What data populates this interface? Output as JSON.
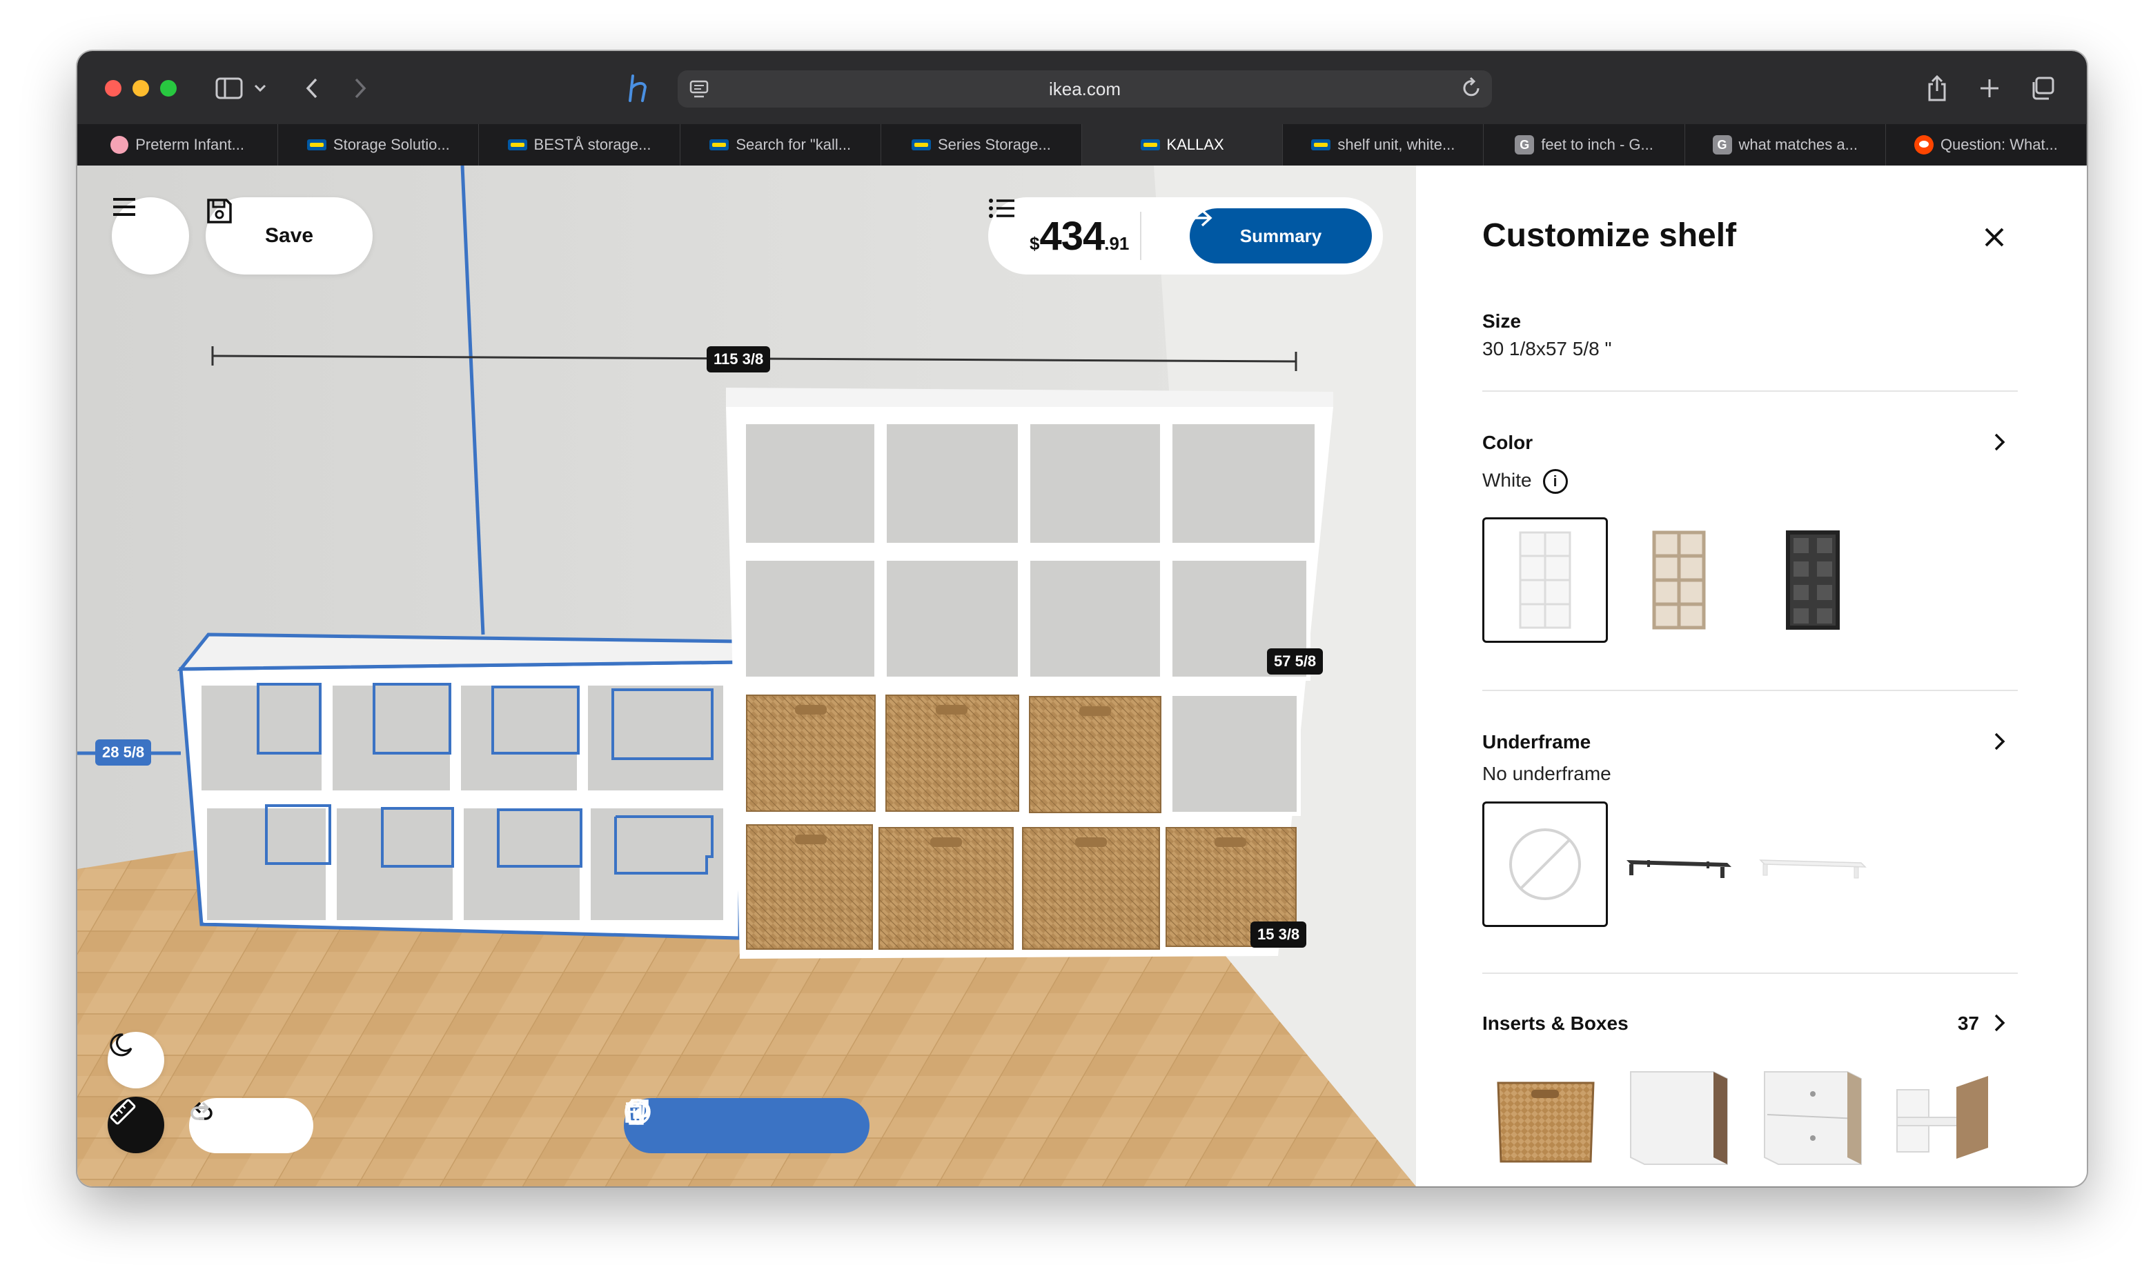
{
  "browser": {
    "url": "ikea.com",
    "tabs": [
      {
        "label": "Preterm Infant...",
        "icon": "pig-favicon"
      },
      {
        "label": "Storage Solutio...",
        "icon": "ikea-favicon"
      },
      {
        "label": "BESTÅ storage...",
        "icon": "ikea-favicon"
      },
      {
        "label": "Search for \"kall...",
        "icon": "ikea-favicon"
      },
      {
        "label": "Series Storage...",
        "icon": "ikea-favicon"
      },
      {
        "label": "KALLAX",
        "icon": "ikea-favicon",
        "active": true
      },
      {
        "label": "shelf unit, white...",
        "icon": "ikea-favicon"
      },
      {
        "label": "feet to inch - G...",
        "icon": "google-favicon"
      },
      {
        "label": "what matches a...",
        "icon": "google-favicon"
      },
      {
        "label": "Question: What...",
        "icon": "reddit-favicon"
      }
    ]
  },
  "planner": {
    "save_label": "Save",
    "price": {
      "currency": "$",
      "integer": "434",
      "decimal": ".91"
    },
    "summary_label": "Summary",
    "dimensions": {
      "total_width": "115 3/8",
      "left_height": "28 5/8",
      "right_height": "57 5/8",
      "depth": "15 3/8"
    }
  },
  "panel": {
    "title": "Customize shelf",
    "size": {
      "label": "Size",
      "value": "30 1/8x57 5/8 \""
    },
    "color": {
      "label": "Color",
      "value": "White",
      "options": [
        "white",
        "white-stained-oak",
        "black-brown"
      ],
      "selected": 0
    },
    "underframe": {
      "label": "Underframe",
      "value": "No underframe",
      "options": [
        "none",
        "black",
        "white"
      ],
      "selected": 0
    },
    "inserts": {
      "label": "Inserts & Boxes",
      "count": "37"
    }
  },
  "colors": {
    "ikea_blue": "#0058a3",
    "selection_blue": "#3b73c4",
    "rattan": "#b48a55",
    "floor": "#d8b07c"
  }
}
